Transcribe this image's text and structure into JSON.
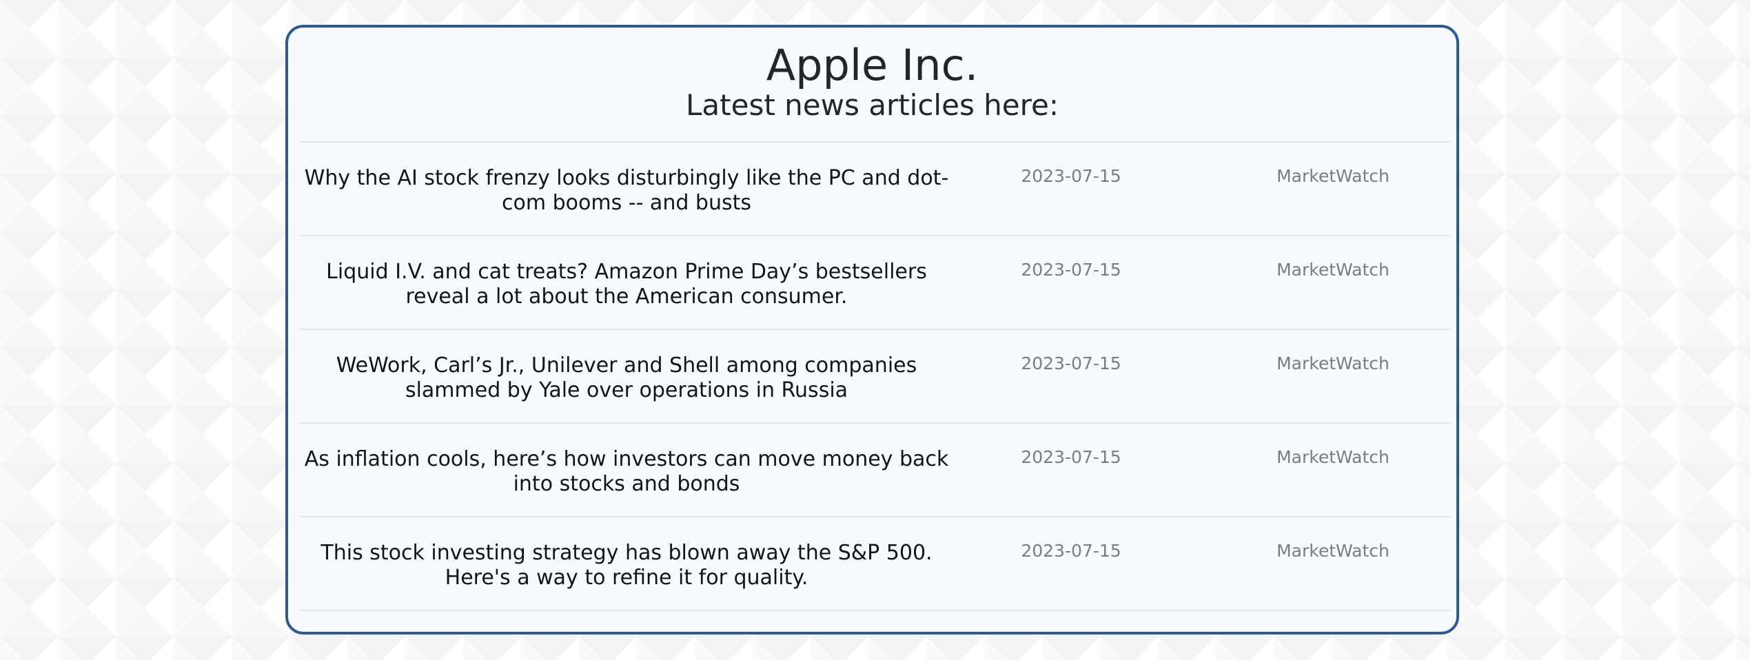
{
  "header": {
    "company": "Apple Inc.",
    "subtitle": "Latest news articles here:"
  },
  "articles": [
    {
      "title": "Why the AI stock frenzy looks disturbingly like the PC and dot-com booms -- and busts",
      "date": "2023-07-15",
      "source": "MarketWatch"
    },
    {
      "title": "Liquid I.V. and cat treats? Amazon Prime Day’s bestsellers reveal a lot about the American consumer.",
      "date": "2023-07-15",
      "source": "MarketWatch"
    },
    {
      "title": "WeWork, Carl’s Jr., Unilever and Shell among companies slammed by Yale over operations in Russia",
      "date": "2023-07-15",
      "source": "MarketWatch"
    },
    {
      "title": "As inflation cools, here’s how investors can move money back into stocks and bonds",
      "date": "2023-07-15",
      "source": "MarketWatch"
    },
    {
      "title": "This stock investing strategy has blown away the S&P 500. Here's a way to refine it for quality.",
      "date": "2023-07-15",
      "source": "MarketWatch"
    }
  ],
  "colors": {
    "border": "#2a5a9a",
    "card_background": "#f7faff",
    "title_text": "#22262b",
    "meta_text": "#777d83"
  }
}
